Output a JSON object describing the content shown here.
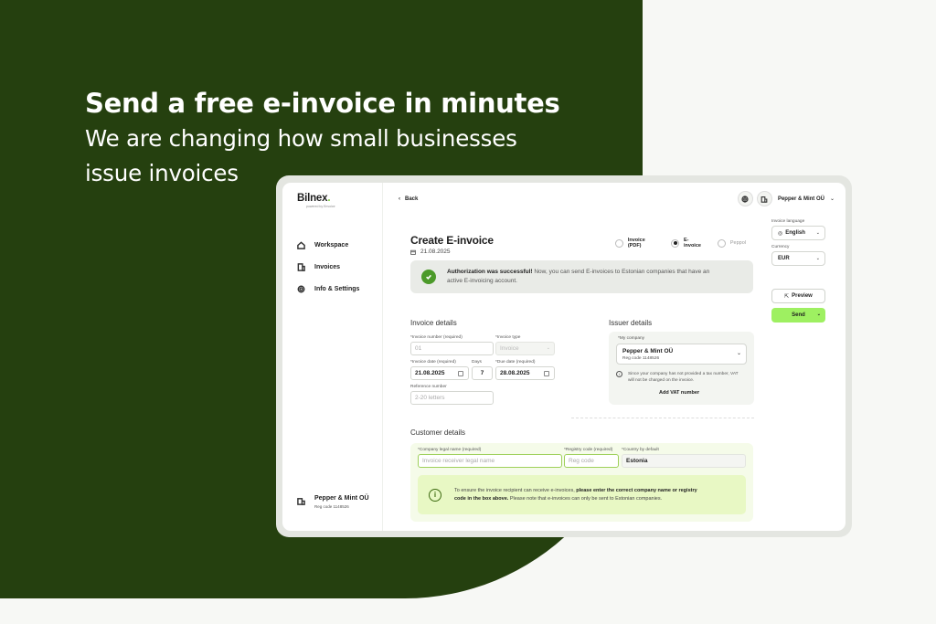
{
  "hero": {
    "title": "Send a free e-invoice in minutes",
    "line1": "We are changing how small businesses",
    "line2": "issue invoices"
  },
  "app": {
    "logo": "Bilnex",
    "logo_sub": "powered by Envoice",
    "nav": [
      {
        "label": "Workspace",
        "icon": "home-icon"
      },
      {
        "label": "Invoices",
        "icon": "invoices-icon"
      },
      {
        "label": "Info & Settings",
        "icon": "gear-icon"
      }
    ],
    "sidebar_company": {
      "name": "Pepper & Mint OÜ",
      "reg": "Reg code 1148526"
    },
    "back": "Back",
    "top_company": "Pepper & Mint OÜ",
    "page_title": "Create E-invoice",
    "page_date": "21.08.2025",
    "radios": [
      {
        "label": "Invoice (PDF)",
        "selected": false
      },
      {
        "label": "E-invoice",
        "selected": true
      },
      {
        "label": "Peppol",
        "selected": false,
        "disabled": true
      }
    ],
    "alert": {
      "bold": "Authorization was successful!",
      "text": " Now, you can send E-invoices to Estonian companies that have an active E-invoicing account."
    },
    "invoice_details": {
      "heading": "Invoice details",
      "number_label": "*Invoice number (required)",
      "number_value": "01",
      "type_label": "*Invoice type",
      "type_value": "Invoice",
      "date_label": "*Invoice date (required)",
      "date_value": "21.08.2025",
      "days_label": "Days",
      "days_value": "7",
      "due_label": "*Due date (required)",
      "due_value": "28.08.2025",
      "ref_label": "Reference number",
      "ref_placeholder": "2-20 letters"
    },
    "issuer_details": {
      "heading": "Issuer details",
      "company_label": "*My company",
      "company_name": "Pepper & Mint OÜ",
      "company_reg": "Reg code 1148526",
      "note": "Since your company has not provided a tax number, VAT will not be charged on the invoice.",
      "add_vat": "Add VAT number"
    },
    "customer_details": {
      "heading": "Customer details",
      "name_label": "*Company legal name (required)",
      "name_placeholder": "Invoice receiver legal name",
      "reg_label": "*Registry code (required)",
      "reg_placeholder": "Reg code",
      "country_label": "*Country by default",
      "country_value": "Estonia",
      "info_pre": "To ensure the invoice recipient can receive e-invoices, ",
      "info_bold": "please enter the correct company name or registry code in the box above.",
      "info_post": " Please note that e-invoices can only be sent to Estonian companies."
    },
    "right": {
      "lang_label": "Invoice language",
      "lang_value": "English",
      "currency_label": "Currency",
      "currency_value": "EUR",
      "preview": "Preview",
      "send": "Send"
    }
  }
}
